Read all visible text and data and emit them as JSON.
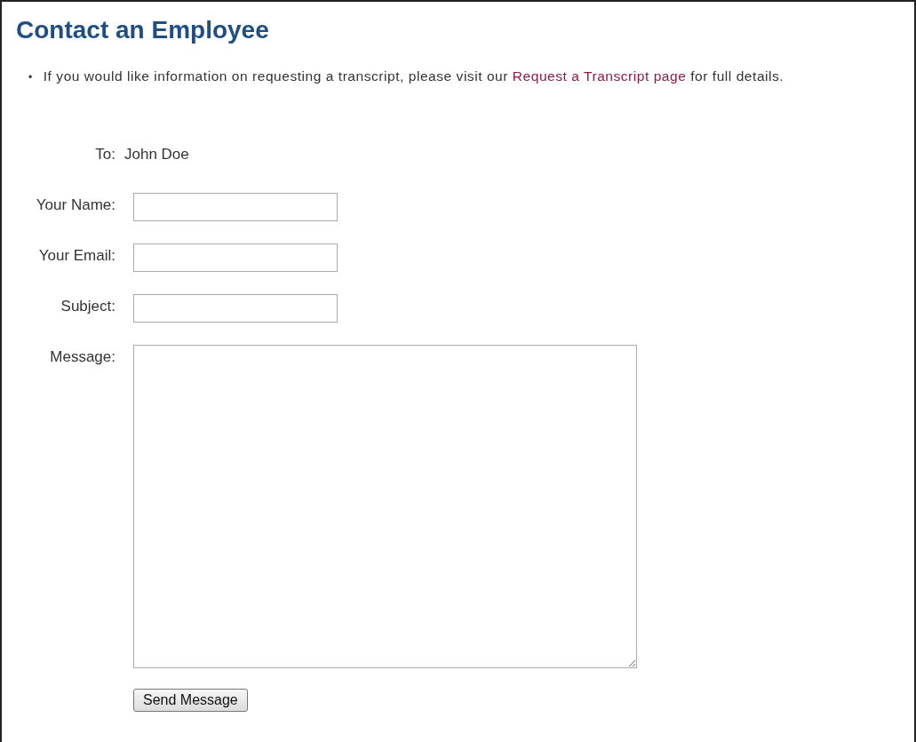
{
  "title": "Contact an Employee",
  "notice": {
    "marker": "•",
    "before": "If you would like information on requesting a transcript, please visit our",
    "link": "Request a Transcript page",
    "after": "for full details."
  },
  "recipient": {
    "label": "To:",
    "value": "John Doe"
  },
  "fields": [
    {
      "label": "Your Name:",
      "kind": "text"
    },
    {
      "label": "Your Email:",
      "kind": "text"
    },
    {
      "label": "Subject:",
      "kind": "text"
    },
    {
      "label": "Message:",
      "kind": "textarea"
    }
  ],
  "submit": "Send Message"
}
